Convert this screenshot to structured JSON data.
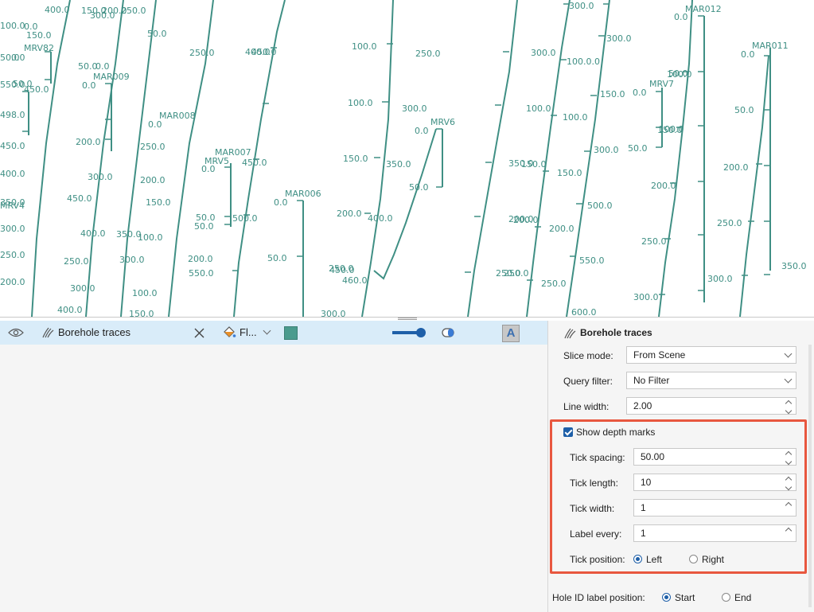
{
  "viewport": {
    "traces": [
      {
        "name": "MAR012",
        "labels": [
          {
            "t": "MAR012"
          },
          {
            "t": "0.0"
          },
          {
            "t": "50.0"
          },
          {
            "t": "100.0"
          },
          {
            "t": "150.0"
          },
          {
            "t": "200.0"
          },
          {
            "t": "250.0"
          }
        ]
      },
      {
        "name": "MAR011",
        "labels": [
          {
            "t": "MAR011"
          },
          {
            "t": "0.0"
          },
          {
            "t": "50.0"
          },
          {
            "t": "100.0"
          },
          {
            "t": "150.0"
          },
          {
            "t": "200.0"
          },
          {
            "t": "150.0"
          }
        ]
      },
      {
        "name": "MRV7",
        "labels": [
          {
            "t": "MRV7"
          },
          {
            "t": "0.0"
          },
          {
            "t": "50.0"
          },
          {
            "t": "100.0"
          }
        ]
      },
      {
        "name": "MRV6",
        "labels": [
          {
            "t": "MRV6"
          },
          {
            "t": "0.0"
          },
          {
            "t": "50.0"
          }
        ]
      },
      {
        "name": "MAR006",
        "labels": [
          {
            "t": "MAR006"
          },
          {
            "t": "0.0"
          },
          {
            "t": "50.0"
          },
          {
            "t": "100.0"
          }
        ]
      },
      {
        "name": "MAR007",
        "labels": [
          {
            "t": "MAR007"
          },
          {
            "t": "0.0"
          },
          {
            "t": "MRV5"
          },
          {
            "t": "50.0"
          },
          {
            "t": "50.0"
          }
        ]
      },
      {
        "name": "MAR008",
        "labels": [
          {
            "t": "MAR008"
          },
          {
            "t": "0.0"
          },
          {
            "t": "50.0"
          },
          {
            "t": "100.0"
          },
          {
            "t": "150.0"
          }
        ]
      },
      {
        "name": "MAR009",
        "labels": [
          {
            "t": "MAR009"
          },
          {
            "t": "0.0"
          },
          {
            "t": "50.0"
          }
        ]
      },
      {
        "name": "MRV82",
        "labels": [
          {
            "t": "MRV82"
          },
          {
            "t": "0.0"
          },
          {
            "t": "50.0"
          }
        ]
      },
      {
        "name": "MRV4",
        "labels": [
          {
            "t": "MRV4"
          }
        ]
      }
    ],
    "depth_labels": [
      "150.0",
      "200.0",
      "250.0",
      "50.0",
      "250.0",
      "450.0",
      "100.0",
      "250.0",
      "300.0",
      "350.0",
      "400.0",
      "450.0",
      "460.0",
      "100.0",
      "150.0",
      "200.0",
      "250.0",
      "300.0",
      "350.0",
      "200.0",
      "250.0",
      "300.0",
      "100.0",
      "150.0",
      "200.0",
      "250.0",
      "300.0",
      "100.0.0",
      "100.0",
      "150.0",
      "200.0",
      "250.0",
      "300.0",
      "150.0",
      "300.0",
      "500.0",
      "550.0",
      "600.0",
      "100.0",
      "150.0",
      "200.0",
      "250.0",
      "300.0",
      "200.0",
      "250.0",
      "300.0",
      "350.0",
      "400.0",
      "450.0",
      "500.0",
      "550.0",
      "100.0",
      "150.0",
      "200.0",
      "100.0",
      "150.0",
      "200.0",
      "250.0",
      "300.0",
      "350.0",
      "400.0",
      "450.0",
      "300.0",
      "200.0",
      "250.0",
      "300.0",
      "400.0",
      "50.0",
      "0.0",
      "300.0",
      "100.0",
      "150.0",
      "200.0",
      "250.0",
      "300.0",
      "350.0",
      "400.0",
      "450.0",
      "498.0",
      "550.0",
      "50.0",
      "0.0",
      "400.0",
      "450.0"
    ]
  },
  "layer_row": {
    "visibility_icon": "eye-icon",
    "layer_icon": "borehole-traces-icon",
    "layer_name": "Borehole traces",
    "close_icon": "close-icon",
    "fill_icon": "paint-bucket-icon",
    "fill_label": "Fl...",
    "dropdown_icon": "chevron-down-icon",
    "color": "#4a9b8e",
    "opacity_icon": "opacity-slider-icon",
    "clip_icon": "clip-icon",
    "label_icon": "text-label-icon",
    "label_glyph": "A"
  },
  "properties": {
    "header": "Borehole traces",
    "slice_mode": {
      "label": "Slice mode:",
      "value": "From Scene"
    },
    "query_filter": {
      "label": "Query filter:",
      "value": "No Filter"
    },
    "line_width": {
      "label": "Line width:",
      "value": "2.00"
    },
    "show_depth_marks": {
      "label": "Show depth marks",
      "checked": true
    },
    "tick_spacing": {
      "label": "Tick spacing:",
      "value": "50.00"
    },
    "tick_length": {
      "label": "Tick length:",
      "value": "10"
    },
    "tick_width": {
      "label": "Tick width:",
      "value": "1"
    },
    "label_every": {
      "label": "Label every:",
      "value": "1"
    },
    "tick_position": {
      "label": "Tick position:",
      "options": [
        "Left",
        "Right"
      ],
      "selected": "Left"
    },
    "hole_id_label_position": {
      "label": "Hole ID label position:",
      "options": [
        "Start",
        "End"
      ],
      "selected": "Start"
    }
  },
  "colors": {
    "accent": "#1e5fa8",
    "highlight": "#e8573f",
    "trace": "#3f8f84",
    "row_selected": "#d9ecf9"
  }
}
